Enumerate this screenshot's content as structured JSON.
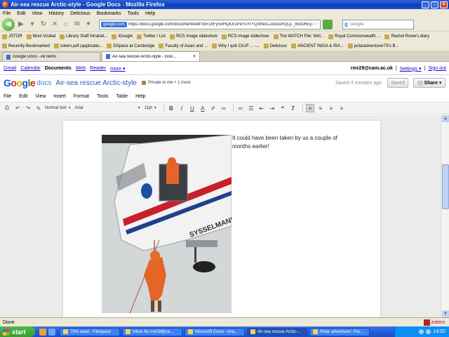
{
  "window": {
    "title": "Air-sea rescue Arctic-style - Google Docs - Mozilla Firefox"
  },
  "menubar": [
    "File",
    "Edit",
    "View",
    "History",
    "Delicious",
    "Bookmarks",
    "Tools",
    "Help"
  ],
  "navbar": {
    "site_badge": "google.com",
    "url": "https://docs.google.com/document/edit?id=1hFySxHQiUr2PeYsYrYQ3tNoCZduusRQLy-_BioOhEy-8bhl=en#",
    "search_placeholder": "Google"
  },
  "bookmarks_row1": [
    "JSTOR",
    "Most Visited",
    "Library Staff Intranet...",
    "iGoogle",
    "Twitter / List",
    "RCS image slideshow",
    "RCS image slideshow",
    "The WATCH File: Writ...",
    "Royal Commonwealth ...",
    "Rachel Rowe's diary"
  ],
  "bookmarks_row2": [
    "Recently Bookmarked",
    "zotero.pdf (applicatio...",
    "DSpace at Cambridge",
    "Faculty of Asian and ...",
    "Why I quit CILIP ... -...",
    "Delicious",
    "ANCIENT INDIA & IRA...",
    "polaradventurer79's B..."
  ],
  "tabs": [
    {
      "label": "Google Docs - All items"
    },
    {
      "label": "Air-sea rescue Arctic-style - Goo..."
    }
  ],
  "google_links": {
    "left": [
      "Gmail",
      "Calendar",
      "Documents",
      "Web",
      "Reader",
      "more ▾"
    ],
    "user": "rmr29@cam.ac.uk",
    "settings": "Settings ▾",
    "signout": "Sign out"
  },
  "docs_header": {
    "logo": "Google",
    "logo_suffix": "docs",
    "document_title": "Air-sea rescue Arctic-style",
    "privacy": "Private to me + 1 more",
    "save_status": "Saved 4 minutes ago",
    "saved_button": "Saved",
    "share_button": "Share ▾"
  },
  "docs_menu": [
    "File",
    "Edit",
    "View",
    "Insert",
    "Format",
    "Tools",
    "Table",
    "Help"
  ],
  "toolbar": {
    "style": "Normal text",
    "font": "Arial",
    "size": "11pt",
    "bold": "B",
    "italic": "I",
    "underline": "U",
    "text_color": "A"
  },
  "document": {
    "text": "It could have been taken by us a couple of months earlier!",
    "image_text": "SYSSELMANNEN"
  },
  "statusbar": {
    "text": "Done",
    "zotero": "zotero"
  },
  "taskbar": {
    "start": "start",
    "tasks": [
      {
        "label": "75% used - Filespace"
      },
      {
        "label": "Inbox for rmr29@ca..."
      },
      {
        "label": "Microsoft Excel - enq..."
      },
      {
        "label": "Air-sea rescue Arctic-..."
      },
      {
        "label": "Polar adventurer: Pre..."
      }
    ],
    "clock": "14:52"
  },
  "colors": {
    "accent": "#2b58b3",
    "link": "#2200cc",
    "taskbar": "#245edb"
  }
}
